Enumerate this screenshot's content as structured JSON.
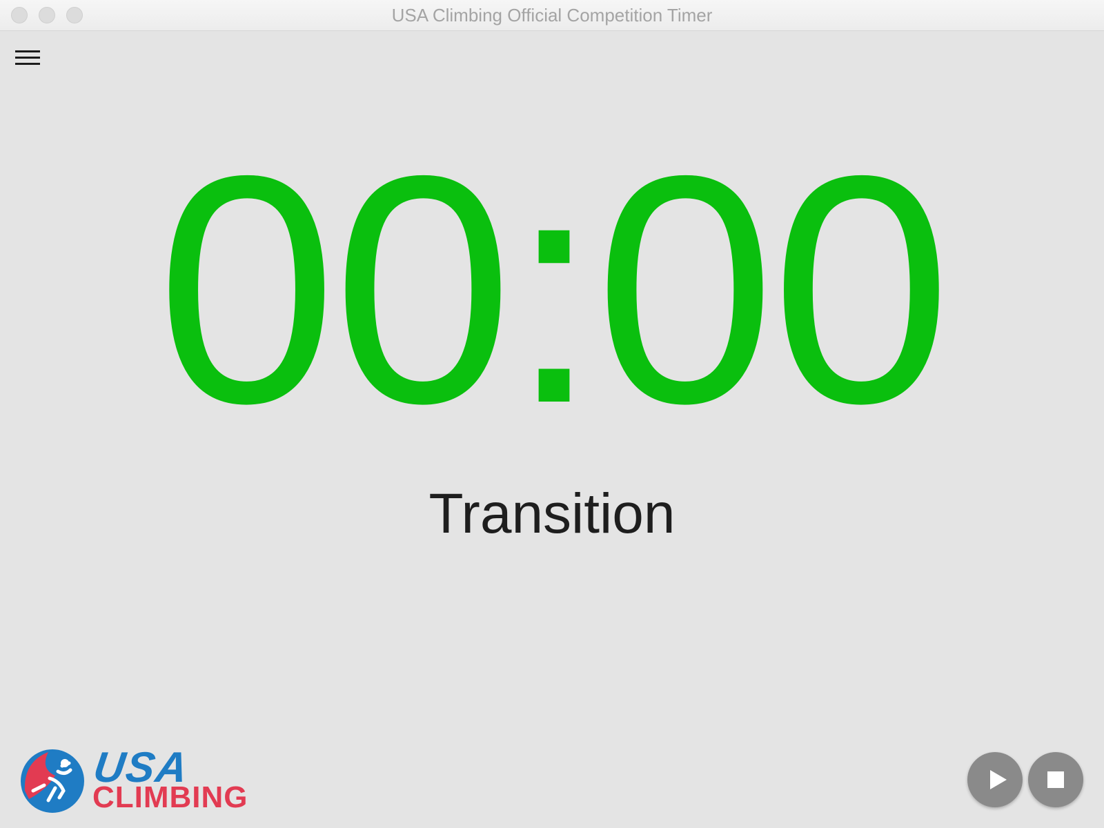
{
  "window": {
    "title": "USA Climbing Official Competition Timer"
  },
  "timer": {
    "display": "00:00",
    "phase": "Transition",
    "color": "#0abf0e"
  },
  "logo": {
    "line1": "USA",
    "line2": "CLIMBING",
    "blue": "#1f7cc4",
    "red": "#e23b52"
  },
  "controls": {
    "menu_icon": "hamburger-icon",
    "play_icon": "play-icon",
    "stop_icon": "stop-icon"
  }
}
